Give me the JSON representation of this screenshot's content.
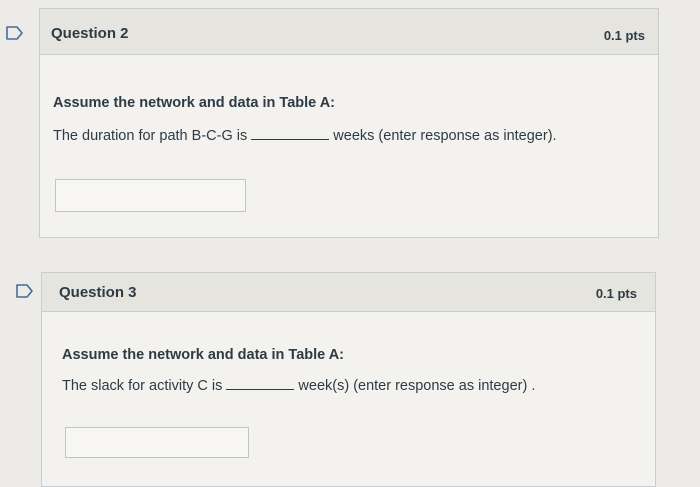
{
  "questions": [
    {
      "title": "Question 2",
      "points": "0.1 pts",
      "prompt_bold": "Assume the network and data in Table A:",
      "prompt_before_blank": "The duration for path B-C-G is",
      "prompt_after_blank": "weeks (enter response as integer).",
      "answer_value": ""
    },
    {
      "title": "Question 3",
      "points": "0.1 pts",
      "prompt_bold": "Assume the network and data in Table A:",
      "prompt_before_blank": "The slack for activity C is",
      "prompt_after_blank": "week(s) (enter response as integer) .",
      "answer_value": ""
    }
  ],
  "icons": {
    "flag": "flag-question-icon"
  },
  "colors": {
    "flag_stroke": "#4a6a9a",
    "text": "#2d3b45",
    "card_bg": "#f3f2ef",
    "header_bg": "#e6e4df"
  }
}
